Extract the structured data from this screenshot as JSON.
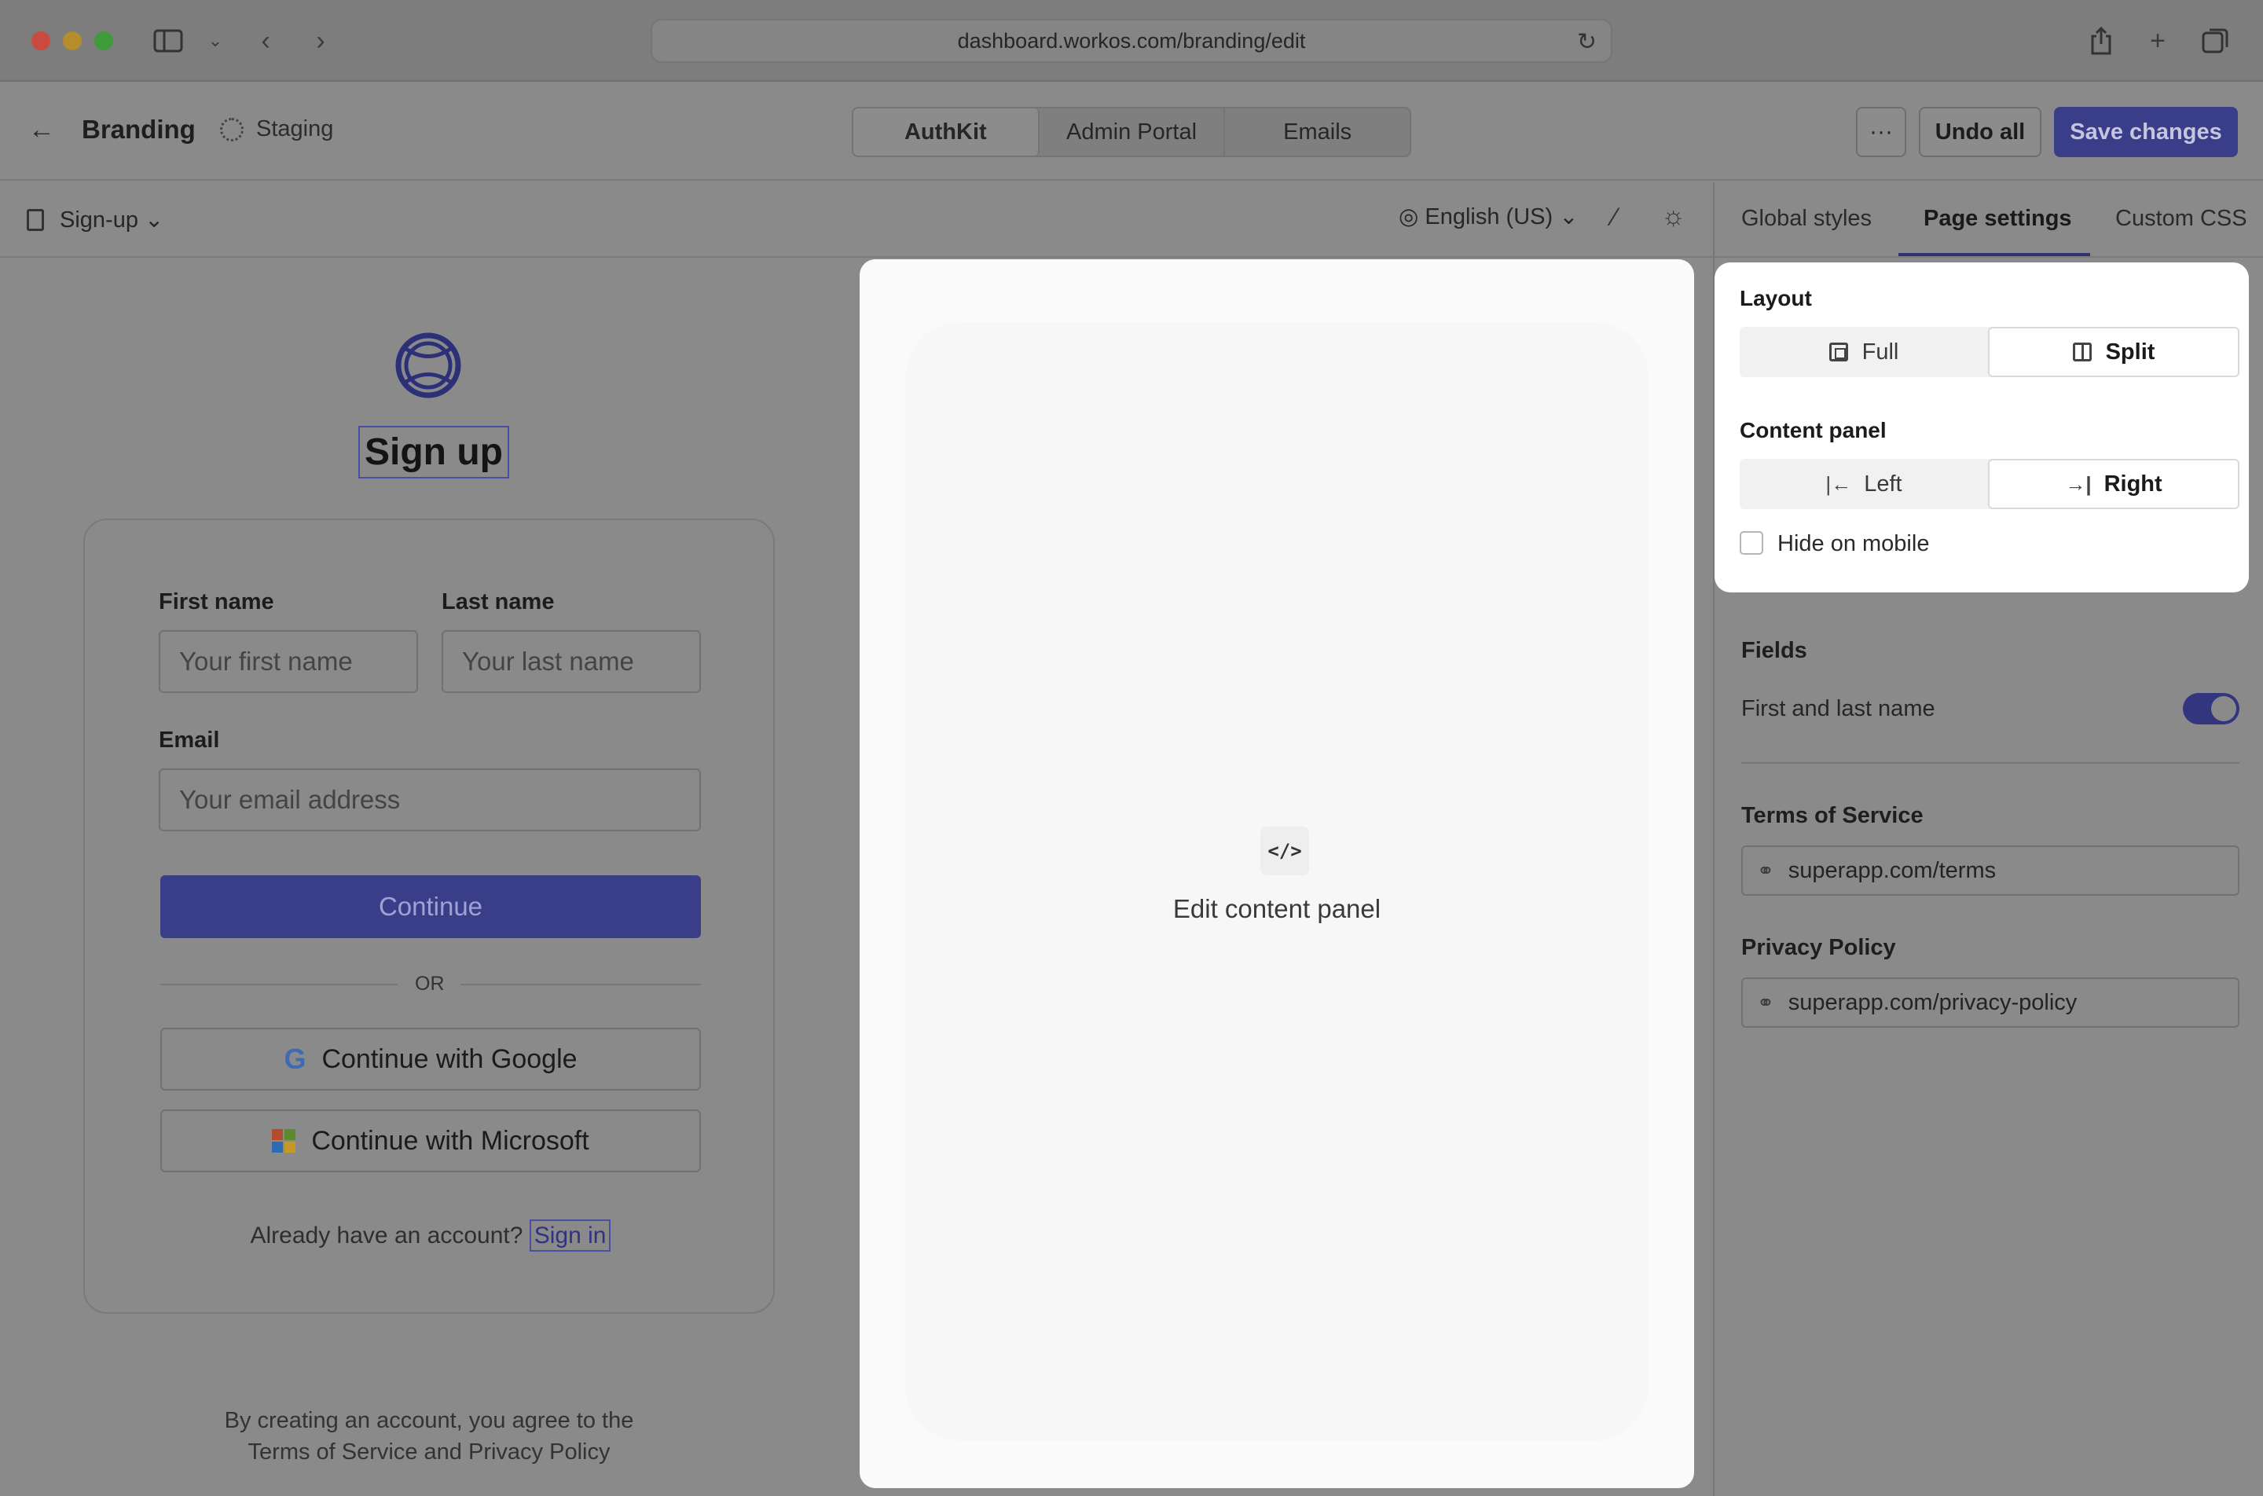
{
  "browser": {
    "url": "dashboard.workos.com/branding/edit"
  },
  "header": {
    "title": "Branding",
    "environment": "Staging",
    "tabs": [
      {
        "label": "AuthKit",
        "active": true
      },
      {
        "label": "Admin Portal",
        "active": false
      },
      {
        "label": "Emails",
        "active": false
      }
    ],
    "more_label": "···",
    "undo_label": "Undo all",
    "save_label": "Save changes"
  },
  "toolbar": {
    "page_select": "Sign-up",
    "language": "English (US)"
  },
  "right_tabs": [
    {
      "label": "Global styles",
      "active": false
    },
    {
      "label": "Page settings",
      "active": true
    },
    {
      "label": "Custom CSS",
      "active": false
    }
  ],
  "preview": {
    "title": "Sign up",
    "first_name_label": "First name",
    "first_name_placeholder": "Your first name",
    "last_name_label": "Last name",
    "last_name_placeholder": "Your last name",
    "email_label": "Email",
    "email_placeholder": "Your email address",
    "continue_label": "Continue",
    "or_label": "OR",
    "google_label": "Continue with Google",
    "microsoft_label": "Continue with Microsoft",
    "account_prompt": "Already have an account?",
    "signin_label": "Sign in",
    "terms_line1": "By creating an account, you agree to the",
    "terms_line2": "Terms of Service and Privacy Policy"
  },
  "content_panel": {
    "edit_label": "Edit content panel",
    "code_icon_text": "</>"
  },
  "popover": {
    "layout_heading": "Layout",
    "layout_options": [
      {
        "label": "Full",
        "selected": false
      },
      {
        "label": "Split",
        "selected": true
      }
    ],
    "content_panel_heading": "Content panel",
    "content_panel_options": [
      {
        "label": "Left",
        "selected": false
      },
      {
        "label": "Right",
        "selected": true
      }
    ],
    "hide_on_mobile_label": "Hide on mobile",
    "hide_on_mobile_checked": false
  },
  "settings": {
    "fields_heading": "Fields",
    "first_last_label": "First and last name",
    "first_last_enabled": true,
    "tos_heading": "Terms of Service",
    "tos_url": "superapp.com/terms",
    "privacy_heading": "Privacy Policy",
    "privacy_url": "superapp.com/privacy-policy"
  },
  "colors": {
    "accent": "#3a3d88",
    "overlay": "#8a8a8a",
    "panel": "#ffffff"
  }
}
